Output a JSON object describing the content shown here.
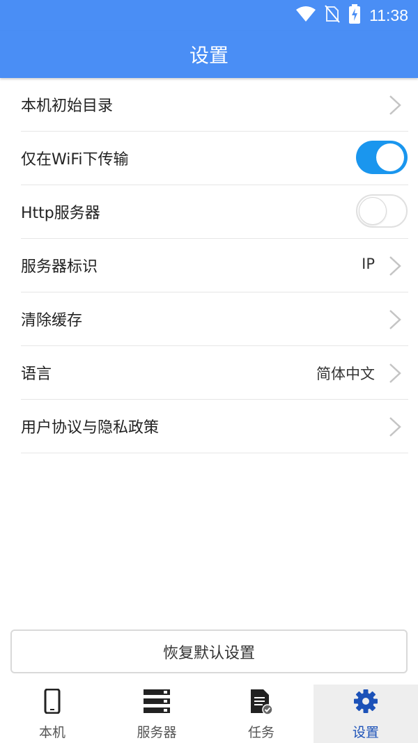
{
  "status_bar": {
    "time": "11:38",
    "icons": [
      "wifi-icon",
      "no-sim-icon",
      "battery-charging-icon"
    ]
  },
  "app_bar": {
    "title": "设置"
  },
  "settings": {
    "items": [
      {
        "label": "本机初始目录",
        "value": "",
        "control": "chevron"
      },
      {
        "label": "仅在WiFi下传输",
        "value": "",
        "control": "toggle",
        "enabled": true
      },
      {
        "label": "Http服务器",
        "value": "",
        "control": "toggle",
        "enabled": false
      },
      {
        "label": "服务器标识",
        "value": "IP",
        "control": "chevron"
      },
      {
        "label": "清除缓存",
        "value": "",
        "control": "chevron"
      },
      {
        "label": "语言",
        "value": "简体中文",
        "control": "chevron"
      },
      {
        "label": "用户协议与隐私政策",
        "value": "",
        "control": "chevron"
      }
    ]
  },
  "restore_button": {
    "label": "恢复默认设置"
  },
  "bottom_nav": {
    "items": [
      {
        "label": "本机",
        "icon": "phone-icon",
        "active": false
      },
      {
        "label": "服务器",
        "icon": "server-icon",
        "active": false
      },
      {
        "label": "任务",
        "icon": "task-document-icon",
        "active": false
      },
      {
        "label": "设置",
        "icon": "gear-icon",
        "active": true
      }
    ]
  },
  "colors": {
    "header": "#4a8ef5",
    "toggle_on": "#1a96ee",
    "active_tab": "#1c52b8"
  }
}
